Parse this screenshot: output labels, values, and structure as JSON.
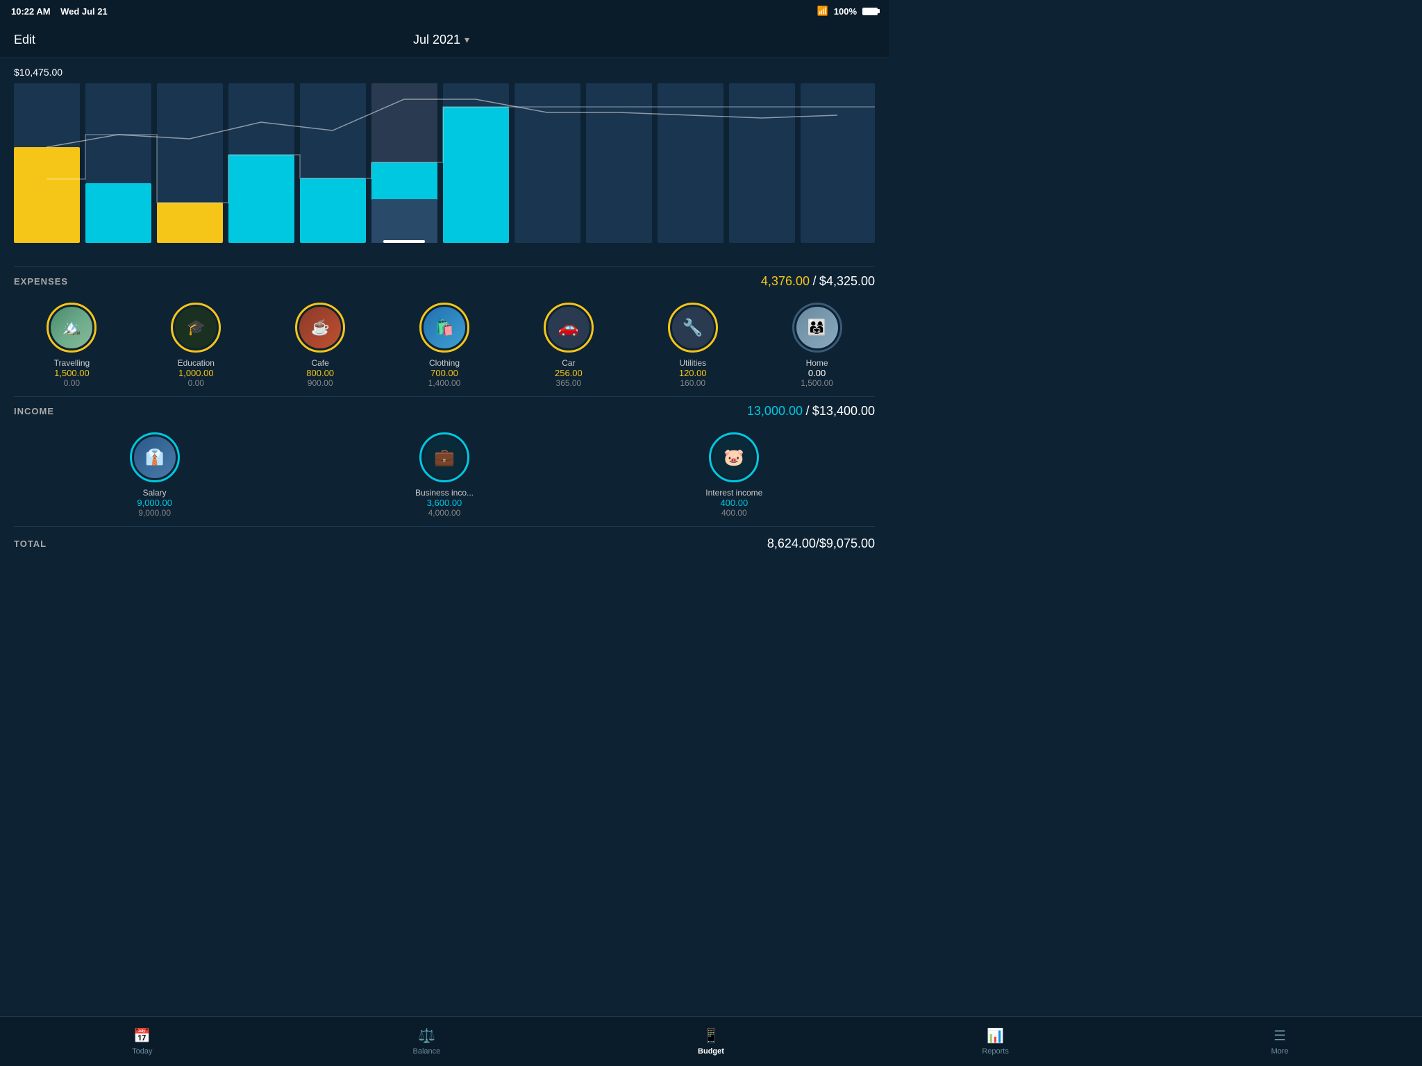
{
  "statusBar": {
    "time": "10:22 AM",
    "date": "Wed Jul 21",
    "wifi": "📶",
    "battery": "100%"
  },
  "header": {
    "editLabel": "Edit",
    "monthLabel": "Jul 2021"
  },
  "chart": {
    "amount": "$10,475.00",
    "bars": [
      {
        "yellow": 60,
        "cyan": 0,
        "total": 55,
        "selected": false
      },
      {
        "yellow": 0,
        "cyan": 30,
        "total": 68,
        "selected": false
      },
      {
        "yellow": 25,
        "cyan": 0,
        "total": 65,
        "selected": false
      },
      {
        "yellow": 0,
        "cyan": 55,
        "total": 80,
        "selected": false
      },
      {
        "yellow": 0,
        "cyan": 30,
        "total": 72,
        "selected": false
      },
      {
        "yellow": 0,
        "cyan": 60,
        "total": 90,
        "selected": true
      },
      {
        "yellow": 0,
        "cyan": 85,
        "total": 95,
        "selected": false
      },
      {
        "yellow": 0,
        "cyan": 0,
        "total": 85,
        "selected": false
      },
      {
        "yellow": 0,
        "cyan": 0,
        "total": 82,
        "selected": false
      },
      {
        "yellow": 0,
        "cyan": 0,
        "total": 80,
        "selected": false
      },
      {
        "yellow": 0,
        "cyan": 0,
        "total": 78,
        "selected": false
      },
      {
        "yellow": 0,
        "cyan": 0,
        "total": 76,
        "selected": false
      }
    ]
  },
  "expenses": {
    "sectionTitle": "EXPENSES",
    "actual": "4,376.00",
    "budget": "$4,325.00",
    "categories": [
      {
        "name": "Travelling",
        "actual": "1,500.00",
        "budget": "0.00",
        "color": "yellow",
        "icon": "🏔️",
        "type": "photo"
      },
      {
        "name": "Education",
        "actual": "1,000.00",
        "budget": "0.00",
        "color": "yellow",
        "icon": "🎓",
        "type": "icon"
      },
      {
        "name": "Cafe",
        "actual": "800.00",
        "budget": "900.00",
        "color": "yellow",
        "icon": "☕",
        "type": "photo"
      },
      {
        "name": "Clothing",
        "actual": "700.00",
        "budget": "1,400.00",
        "color": "yellow",
        "icon": "🛍️",
        "type": "photo"
      },
      {
        "name": "Car",
        "actual": "256.00",
        "budget": "365.00",
        "color": "yellow",
        "icon": "🚗",
        "type": "icon"
      },
      {
        "name": "Utilities",
        "actual": "120.00",
        "budget": "160.00",
        "color": "yellow",
        "icon": "🔧",
        "type": "icon"
      },
      {
        "name": "Home",
        "actual": "0.00",
        "budget": "1,500.00",
        "color": "white",
        "icon": "👨‍👩‍👧",
        "type": "photo"
      }
    ]
  },
  "income": {
    "sectionTitle": "INCOME",
    "actual": "13,000.00",
    "budget": "$13,400.00",
    "categories": [
      {
        "name": "Salary",
        "actual": "9,000.00",
        "budget": "9,000.00",
        "color": "cyan",
        "icon": "👔",
        "type": "photo"
      },
      {
        "name": "Business inco...",
        "actual": "3,600.00",
        "budget": "4,000.00",
        "color": "cyan",
        "icon": "💼",
        "type": "icon"
      },
      {
        "name": "Interest income",
        "actual": "400.00",
        "budget": "400.00",
        "color": "cyan",
        "icon": "🐷",
        "type": "icon"
      }
    ]
  },
  "total": {
    "label": "TOTAL",
    "amount": "8,624.00/$9,075.00"
  },
  "tabBar": {
    "tabs": [
      {
        "label": "Today",
        "icon": "📅",
        "active": false
      },
      {
        "label": "Balance",
        "icon": "⚖️",
        "active": false
      },
      {
        "label": "Budget",
        "icon": "📱",
        "active": true
      },
      {
        "label": "Reports",
        "icon": "📊",
        "active": false
      },
      {
        "label": "More",
        "icon": "☰",
        "active": false
      }
    ]
  }
}
